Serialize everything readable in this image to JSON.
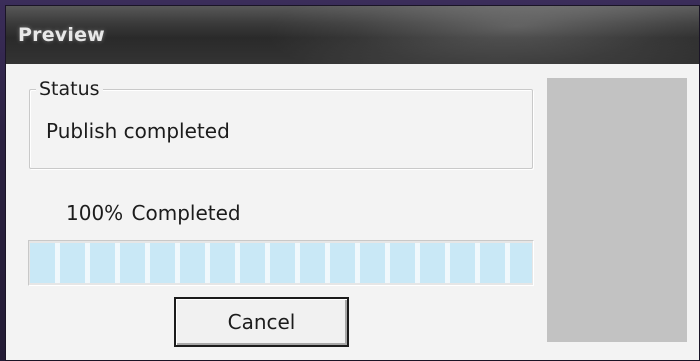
{
  "window": {
    "title": "Preview"
  },
  "status": {
    "group_label": "Status",
    "message": "Publish completed"
  },
  "progress": {
    "label": "100% Completed",
    "fraction": 1.0
  },
  "buttons": {
    "cancel_label": "Cancel"
  },
  "colors": {
    "titlebar": "#333333",
    "progress_segment": "#c9e8f6",
    "preview_pane": "#c2c2c2"
  }
}
